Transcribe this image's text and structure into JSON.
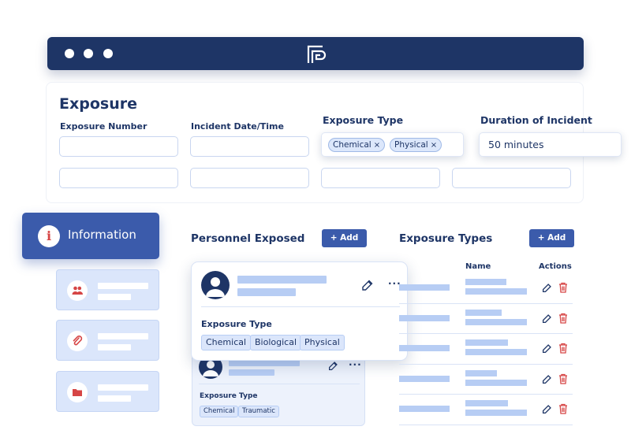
{
  "browser": {
    "logo_icon": "formsite-logo-icon"
  },
  "exposure": {
    "title": "Exposure",
    "fields": {
      "number_label": "Exposure Number",
      "date_label": "Incident Date/Time",
      "type_label": "Exposure Type",
      "duration_label": "Duration of Incident",
      "duration_value": "50 minutes"
    },
    "type_chips": [
      "Chemical",
      "Physical"
    ],
    "chip_remove": "×"
  },
  "sidebar": {
    "active": {
      "label": "Information",
      "icon": "info-icon",
      "icon_glyph": "i"
    },
    "items": [
      {
        "icon": "people-icon"
      },
      {
        "icon": "paperclip-icon"
      },
      {
        "icon": "folder-icon"
      }
    ]
  },
  "personnel": {
    "title": "Personnel Exposed",
    "add_label": "+ Add",
    "front_card": {
      "sub_label": "Exposure Type",
      "chips": [
        "Chemical",
        "Biological",
        "Physical"
      ],
      "more": "···"
    },
    "back_card": {
      "sub_label": "Exposure Type",
      "chips": [
        "Chemical",
        "Traumatic"
      ],
      "more": "···"
    }
  },
  "exposure_types": {
    "title": "Exposure Types",
    "add_label": "+ Add",
    "columns": {
      "name": "Name",
      "actions": "Actions"
    },
    "row_count": 5
  },
  "colors": {
    "navy": "#1e3566",
    "accent": "#3b5bab",
    "placeholder": "#b7cdf4",
    "danger": "#d64545"
  }
}
